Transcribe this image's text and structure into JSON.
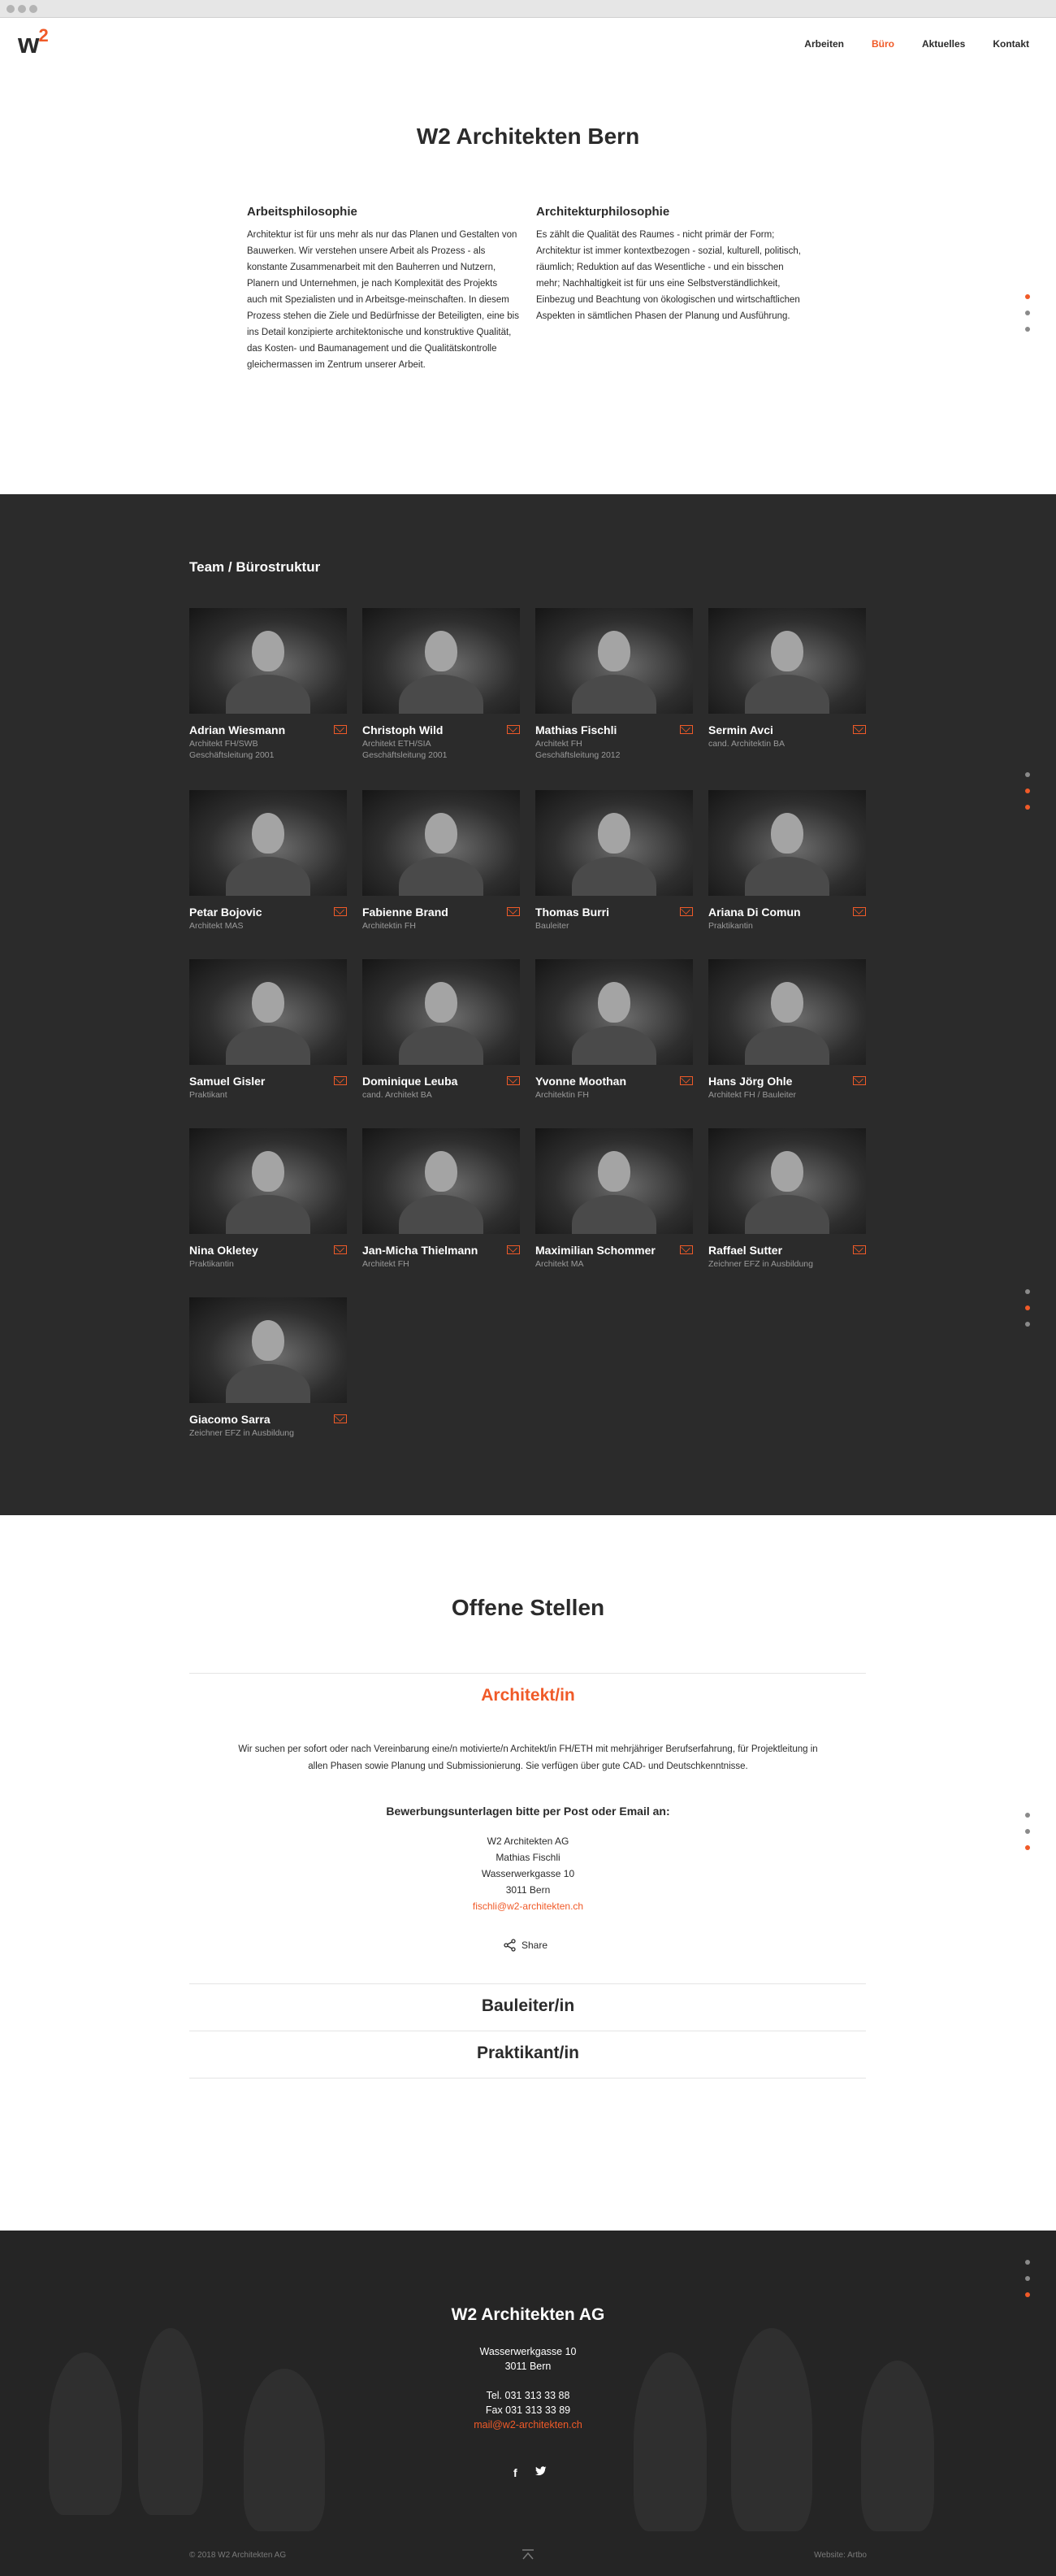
{
  "browser": {
    "dots": [
      "close",
      "minimize",
      "maximize"
    ]
  },
  "header": {
    "logo": {
      "text": "w",
      "superscript": "2"
    },
    "nav": [
      {
        "label": "Arbeiten",
        "active": false
      },
      {
        "label": "Büro",
        "active": true
      },
      {
        "label": "Aktuelles",
        "active": false
      },
      {
        "label": "Kontakt",
        "active": false
      }
    ]
  },
  "colors": {
    "accent": "#f05a28",
    "dark_bg": "#2b2b2b",
    "text": "#2b2b2b"
  },
  "intro": {
    "title": "W2 Architekten Bern",
    "left": {
      "heading": "Arbeitsphilosophie",
      "text": "Architektur ist für uns mehr als nur das Planen und Gestalten von Bauwerken. Wir verstehen unsere Arbeit als Prozess - als konstante Zusammenarbeit mit den Bauherren und Nutzern, Planern und Unternehmen, je nach Komplexität des Projekts auch mit Spezialisten und in Arbeitsge-meinschaften. In diesem Prozess stehen die Ziele und Bedürfnisse der Beteiligten, eine bis ins Detail konzipierte architektonische und konstruktive Qualität, das Kosten- und Baumanagement und die Qualitätskontrolle gleichermassen im Zentrum unserer Arbeit."
    },
    "right": {
      "heading": "Architekturphilosophie",
      "text": "Es zählt die Qualität des Raumes - nicht primär der Form; Architektur ist immer kontextbezogen - sozial, kulturell, politisch, räumlich; Reduktion auf das Wesentliche - und ein bisschen mehr; Nachhaltigkeit ist für uns eine Selbstverständlichkeit, Einbezug und Beachtung von ökologischen und wirtschaftlichen Aspekten in sämtlichen Phasen der Planung und Ausführung."
    }
  },
  "team": {
    "title": "Team / Bürostruktur",
    "members": [
      {
        "name": "Adrian Wiesmann",
        "role": "Architekt FH/SWB",
        "role2": "Geschäftsleitung 2001"
      },
      {
        "name": "Christoph Wild",
        "role": "Architekt ETH/SIA",
        "role2": "Geschäftsleitung 2001"
      },
      {
        "name": "Mathias Fischli",
        "role": "Architekt FH",
        "role2": "Geschäftsleitung 2012"
      },
      {
        "name": "Sermin Avci",
        "role": "cand. Architektin BA",
        "role2": ""
      },
      {
        "name": "Petar Bojovic",
        "role": "Architekt MAS",
        "role2": ""
      },
      {
        "name": "Fabienne Brand",
        "role": "Architektin FH",
        "role2": ""
      },
      {
        "name": "Thomas Burri",
        "role": "Bauleiter",
        "role2": ""
      },
      {
        "name": "Ariana Di Comun",
        "role": "Praktikantin",
        "role2": ""
      },
      {
        "name": "Samuel Gisler",
        "role": "Praktikant",
        "role2": ""
      },
      {
        "name": "Dominique Leuba",
        "role": "cand. Architekt BA",
        "role2": ""
      },
      {
        "name": "Yvonne Moothan",
        "role": "Architektin FH",
        "role2": ""
      },
      {
        "name": "Hans Jörg Ohle",
        "role": "Architekt FH / Bauleiter",
        "role2": ""
      },
      {
        "name": "Nina Okletey",
        "role": "Praktikantin",
        "role2": ""
      },
      {
        "name": "Jan-Micha Thielmann",
        "role": "Architekt FH",
        "role2": ""
      },
      {
        "name": "Maximilian Schommer",
        "role": "Architekt MA",
        "role2": ""
      },
      {
        "name": "Raffael Sutter",
        "role": "Zeichner EFZ in Ausbildung",
        "role2": ""
      },
      {
        "name": "Giacomo Sarra",
        "role": "Zeichner EFZ in Ausbildung",
        "role2": ""
      }
    ]
  },
  "jobs": {
    "title": "Offene Stellen",
    "open_job": {
      "title": "Architekt/in",
      "description": "Wir suchen per sofort oder nach Vereinbarung eine/n motivierte/n Architekt/in FH/ETH mit mehrjähriger Berufserfahrung, für Projektleitung in allen Phasen sowie Planung und Submissionierung. Sie verfügen über gute CAD- und Deutschkenntnisse.",
      "apply_heading": "Bewerbungsunterlagen bitte per Post oder Email an:",
      "address": [
        "W2 Architekten AG",
        "Mathias Fischli",
        "Wasserwerkgasse 10",
        "3011 Bern"
      ],
      "email": "fischli@w2-architekten.ch",
      "share_label": "Share"
    },
    "collapsed": [
      "Bauleiter/in",
      "Praktikant/in"
    ]
  },
  "footer": {
    "title": "W2 Architekten AG",
    "street": "Wasserwerkgasse 10",
    "city": "3011 Bern",
    "tel": "Tel. 031 313 33 88",
    "fax": "Fax 031 313 33 89",
    "email": "mail@w2-architekten.ch",
    "social": [
      "f",
      "twitter"
    ],
    "copyright": "© 2018 W2 Architekten AG",
    "website": "Website: Artbo"
  }
}
